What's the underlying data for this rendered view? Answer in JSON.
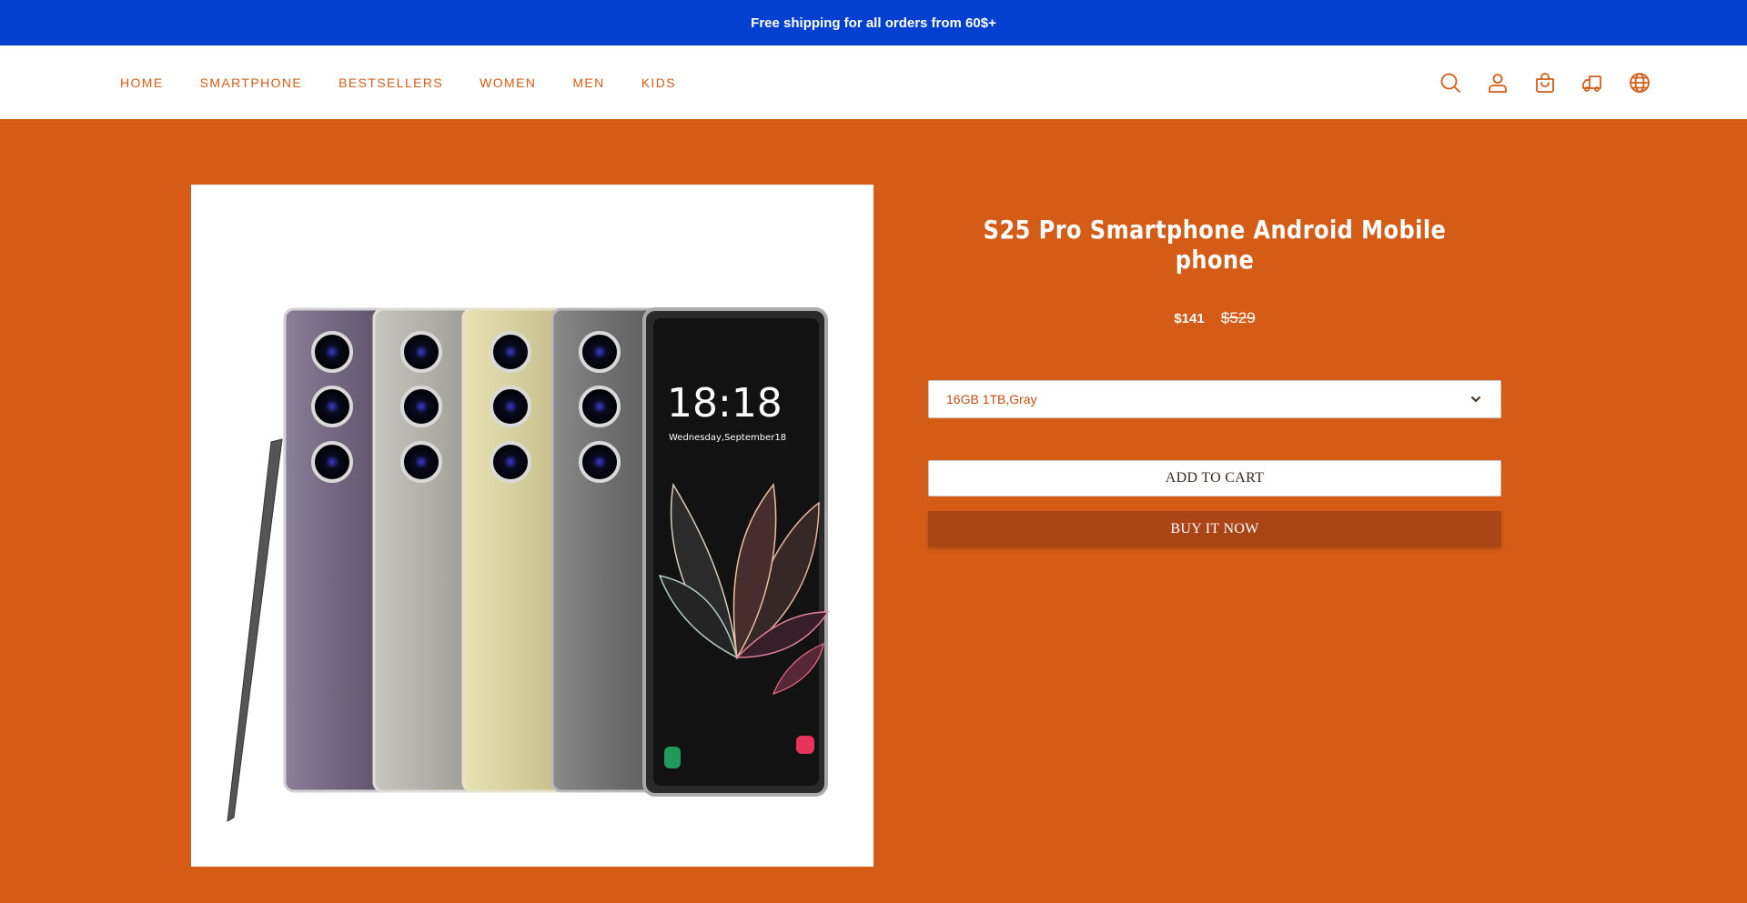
{
  "announcement": "Free shipping for all orders from 60$+",
  "nav": {
    "items": [
      {
        "label": "HOME",
        "name": "nav-home"
      },
      {
        "label": "SMARTPHONE",
        "name": "nav-smartphone"
      },
      {
        "label": "BESTSELLERS",
        "name": "nav-bestsellers"
      },
      {
        "label": "WOMEN",
        "name": "nav-women"
      },
      {
        "label": "MEN",
        "name": "nav-men"
      },
      {
        "label": "KIDS",
        "name": "nav-kids"
      }
    ]
  },
  "header_icons": [
    "search-icon",
    "account-icon",
    "cart-icon",
    "shipping-truck-icon",
    "language-globe-icon"
  ],
  "product": {
    "title": "S25 Pro Smartphone Android Mobile phone",
    "price": "$141",
    "compare_price": "$529",
    "variant_selected": "16GB 1TB,Gray",
    "add_to_cart_label": "ADD TO CART",
    "buy_now_label": "BUY IT NOW",
    "screen_time": "18:18",
    "screen_date": "Wednesday,September18"
  },
  "colors": {
    "announcement_bg": "#0340d0",
    "page_bg": "#d55c17",
    "accent": "#d55c17",
    "buy_button_bg": "#a94516"
  }
}
